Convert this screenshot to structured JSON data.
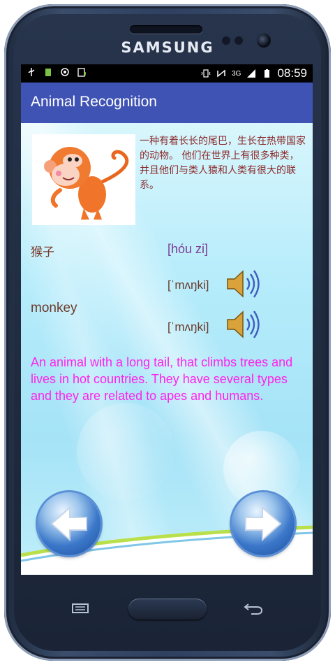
{
  "device": {
    "brand": "SAMSUNG"
  },
  "status_bar": {
    "time": "08:59",
    "network": "3G",
    "icons_left": [
      "usb-icon",
      "battery-saver-icon",
      "sync-icon",
      "download-icon"
    ],
    "icons_right": [
      "vibrate-icon",
      "nfc-icon",
      "signal-icon",
      "battery-icon"
    ]
  },
  "app_bar": {
    "title": "Animal Recognition"
  },
  "card": {
    "image": "monkey-illustration",
    "description_cn": "一种有着长长的尾巴，生长在热带国家的动物。 他们在世界上有很多种类，并且他们与类人猿和人类有很大的联系。",
    "word_cn": "猴子",
    "pinyin": "[hóu zi]",
    "word_en": "monkey",
    "phonetic_uk": "[ˈmʌŋki]",
    "phonetic_us": "[ˈmʌŋki]",
    "description_en": "An animal with a long tail, that climbs trees and lives in hot countries. They have several types and they are related to apes and humans."
  },
  "navigation": {
    "prev_icon": "arrow-left-icon",
    "next_icon": "arrow-right-icon"
  },
  "colors": {
    "app_bar": "#3f53b4",
    "definition_text": "#ff22ee",
    "chinese_text": "#8b2b2b"
  }
}
